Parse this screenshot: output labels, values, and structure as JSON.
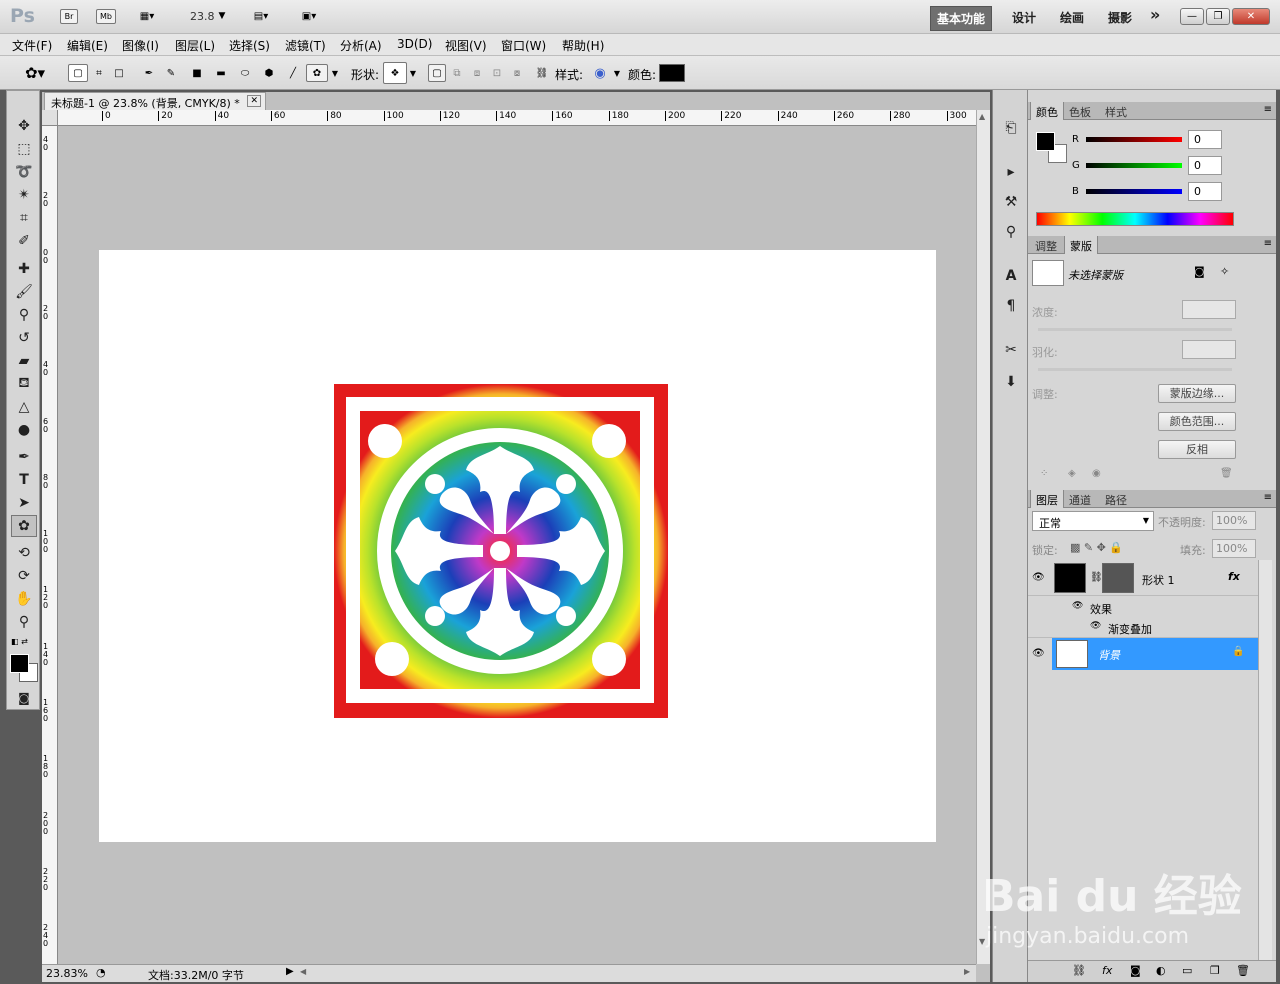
{
  "app": {
    "logo": "Ps",
    "zoom": "23.8"
  },
  "workspace": {
    "active": "基本功能",
    "others": [
      "设计",
      "绘画",
      "摄影"
    ],
    "more": "»"
  },
  "menu": [
    "文件(F)",
    "编辑(E)",
    "图像(I)",
    "图层(L)",
    "选择(S)",
    "滤镜(T)",
    "分析(A)",
    "3D(D)",
    "视图(V)",
    "窗口(W)",
    "帮助(H)"
  ],
  "options": {
    "shape_label": "形状:",
    "style_label": "样式:",
    "color_label": "颜色:"
  },
  "document": {
    "tab_title": "未标题-1 @ 23.8% (背景, CMYK/8) *"
  },
  "ruler": {
    "h": [
      "0",
      "20",
      "40",
      "60",
      "80",
      "100",
      "120",
      "140",
      "160",
      "180",
      "200",
      "220",
      "240",
      "260",
      "280",
      "300"
    ],
    "v": [
      "4",
      "2",
      "0",
      "2",
      "4",
      "6",
      "8",
      "10",
      "12",
      "14",
      "16",
      "18",
      "20",
      "22",
      "24"
    ]
  },
  "status": {
    "zoom": "23.83%",
    "doc": "文档:33.2M/0 字节"
  },
  "color_panel": {
    "tabs": [
      "颜色",
      "色板",
      "样式"
    ],
    "channels": [
      {
        "label": "R",
        "value": "0"
      },
      {
        "label": "G",
        "value": "0"
      },
      {
        "label": "B",
        "value": "0"
      }
    ]
  },
  "mask_panel": {
    "tabs": [
      "调整",
      "蒙版"
    ],
    "title": "未选择蒙版",
    "density_label": "浓度:",
    "feather_label": "羽化:",
    "refine_label": "调整:",
    "buttons": [
      "蒙版边缘...",
      "颜色范围...",
      "反相"
    ]
  },
  "layers_panel": {
    "tabs": [
      "图层",
      "通道",
      "路径"
    ],
    "blend_mode": "正常",
    "opacity_label": "不透明度:",
    "opacity": "100%",
    "lock_label": "锁定:",
    "fill_label": "填充:",
    "fill": "100%",
    "layers": [
      {
        "name": "形状 1",
        "fx": "fx",
        "effects_label": "效果",
        "effect": "渐变叠加"
      },
      {
        "name": "背景"
      }
    ]
  },
  "watermark": {
    "brand": "Bai du 经验",
    "url": "jingyan.baidu.com"
  },
  "colors": {
    "selection": "#3399ff",
    "fg": "#000000",
    "bg": "#ffffff"
  }
}
